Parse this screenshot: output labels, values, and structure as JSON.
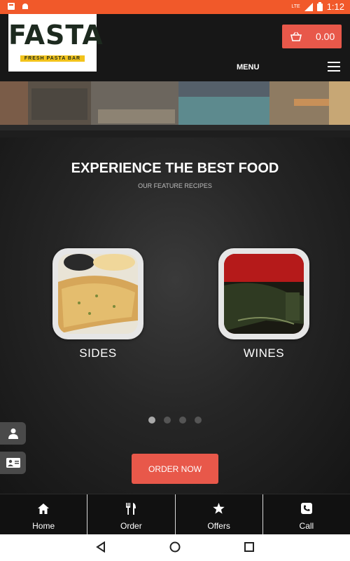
{
  "status_bar": {
    "time": "1:12",
    "network": "LTE",
    "icons": [
      "notification-icon",
      "android-icon",
      "signal-icon",
      "battery-icon"
    ]
  },
  "header": {
    "logo_text": "FASTA",
    "logo_tagline": "FRESH PASTA BAR",
    "cart_amount": "0.00",
    "menu_label": "MENU"
  },
  "hero": {
    "title": "EXPERIENCE THE BEST FOOD",
    "subtitle": "OUR FEATURE RECIPES",
    "cards": [
      {
        "label": "SIDES"
      },
      {
        "label": "WINES"
      }
    ],
    "carousel_pages": 4,
    "carousel_active": 1,
    "order_button": "ORDER NOW"
  },
  "bottom_nav": [
    {
      "label": "Home",
      "icon": "home-icon"
    },
    {
      "label": "Order",
      "icon": "cutlery-icon"
    },
    {
      "label": "Offers",
      "icon": "star-icon"
    },
    {
      "label": "Call",
      "icon": "phone-icon"
    }
  ],
  "colors": {
    "accent": "#e8584a",
    "status_bar": "#f1592a",
    "logo_yellow": "#f2c31b"
  }
}
